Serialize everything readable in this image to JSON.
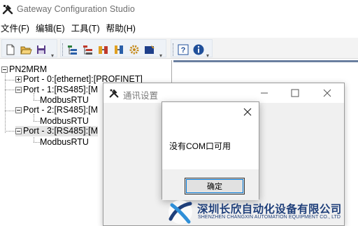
{
  "app": {
    "title": "Gateway Configuration Studio"
  },
  "menu": [
    {
      "label": "文件(F)"
    },
    {
      "label": "编辑(E)"
    },
    {
      "label": "工具(T)"
    },
    {
      "label": "帮助(H)"
    }
  ],
  "toolbar": {
    "icons": [
      "new-file-icon",
      "open-folder-icon",
      "save-icon",
      "add-port-icon",
      "remove-port-icon",
      "read-config-icon",
      "write-config-icon",
      "settings-gear-icon",
      "download-icon",
      "help-icon",
      "info-icon"
    ]
  },
  "tree": {
    "root": "PN2MRM",
    "nodes": [
      {
        "label": "Port - 0:[ethernet]:[PROFINET]",
        "child": null
      },
      {
        "label": "Port - 1:[RS485]:[M",
        "child": "ModbusRTU"
      },
      {
        "label": "Port - 2:[RS485]:[M",
        "child": "ModbusRTU"
      },
      {
        "label": "Port - 3:[RS485]:[M",
        "child": "ModbusRTU"
      }
    ]
  },
  "comm_dialog": {
    "title": "通讯设置"
  },
  "message_box": {
    "text": "没有COM口可用",
    "ok_label": "确定"
  },
  "watermark": {
    "company_cn": "深圳长欣自动化设备有限公司",
    "company_en": "SHENZHEN CHANGXIN AUTOMATION EQUIPMENT CO., LTD",
    "brand_color": "#1f3f7a"
  }
}
